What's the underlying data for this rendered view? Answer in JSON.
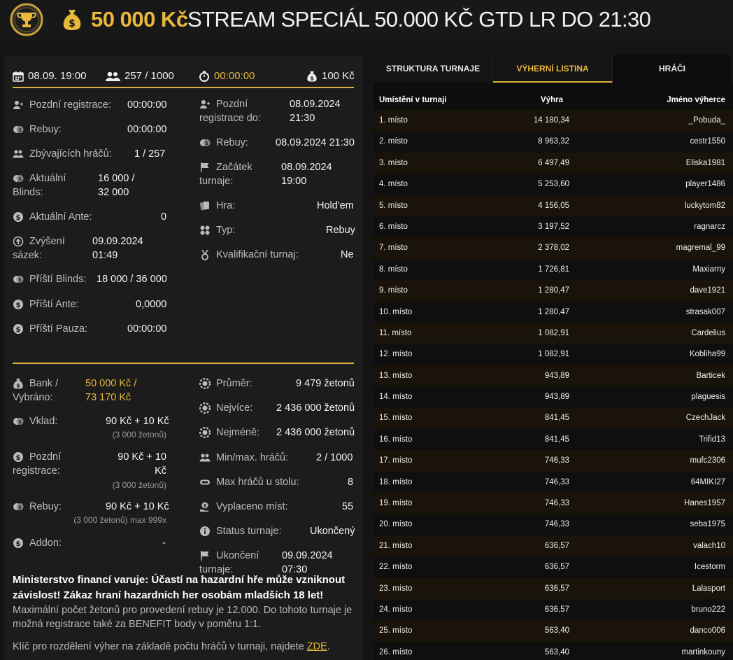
{
  "header": {
    "amount": "50 000 Kč",
    "title": "STREAM SPECIÁL 50.000 KČ GTD LR DO 21:30",
    "icons": [
      "trophy-icon",
      "money-bag-icon"
    ],
    "accent_color": "#e8b83b"
  },
  "topbar": {
    "date": "08.09. 19:00",
    "players": "257 / 1000",
    "timer": "00:00:00",
    "buyin": "100 Kč"
  },
  "info_left": [
    {
      "label": "Pozdní registrace:",
      "value": "00:00:00"
    },
    {
      "label": "Rebuy:",
      "value": "00:00:00"
    },
    {
      "label": "Zbývajících hráčů:",
      "value": "1 / 257"
    },
    {
      "label": "Aktuální Blinds:",
      "value": "16 000 / 32 000"
    },
    {
      "label": "Aktuální Ante:",
      "value": "0"
    },
    {
      "label": "Zvýšení sázek:",
      "value": "09.09.2024 01:49"
    },
    {
      "label": "Příští Blinds:",
      "value": "18 000 / 36 000"
    },
    {
      "label": "Příští Ante:",
      "value": "0,0000"
    },
    {
      "label": "Příští Pauza:",
      "value": "00:00:00"
    }
  ],
  "info_right": [
    {
      "label": "Pozdní registrace do:",
      "value": "08.09.2024 21:30"
    },
    {
      "label": "Rebuy:",
      "value": "08.09.2024 21:30"
    },
    {
      "label": "Začátek turnaje:",
      "value": "08.09.2024 19:00"
    },
    {
      "label": "Hra:",
      "value": "Hold'em"
    },
    {
      "label": "Typ:",
      "value": "Rebuy"
    },
    {
      "label": "Kvalifikační turnaj:",
      "value": "Ne"
    }
  ],
  "money_left": [
    {
      "label": "Bank / Vybráno:",
      "value": "50 000 Kč / 73 170 Kč"
    },
    {
      "label": "Vklad:",
      "value": "90 Kč + 10 Kč",
      "sub": "(3 000 žetonů)"
    },
    {
      "label": "Pozdní registrace:",
      "value": "90 Kč + 10 Kč",
      "sub": "(3 000 žetonů)"
    },
    {
      "label": "Rebuy:",
      "value": "90 Kč + 10 Kč",
      "sub": "(3 000 žetonů) max 999x"
    },
    {
      "label": "Addon:",
      "value": "-"
    }
  ],
  "money_right": [
    {
      "label": "Průměr:",
      "value": "9 479 žetonů"
    },
    {
      "label": "Nejvíce:",
      "value": "2 436 000 žetonů"
    },
    {
      "label": "Nejméně:",
      "value": "2 436 000 žetonů"
    },
    {
      "label": "Min/max. hráčů:",
      "value": "2 / 1000"
    },
    {
      "label": "Max hráčů u stolu:",
      "value": "8"
    },
    {
      "label": "Vyplaceno míst:",
      "value": "55"
    },
    {
      "label": "Status turnaje:",
      "value": "Ukončený"
    },
    {
      "label": "Ukončení turnaje:",
      "value": "09.09.2024 07:30"
    }
  ],
  "warning": "Ministerstvo financí varuje: Účastí na hazardní hře může vzniknout závislost! Zákaz hraní hazardních her osobám mladších 18 let!",
  "note": "Maximální počet žetonů pro provedení rebuy je 12.000. Do tohoto turnaje je možná registrace také za BENEFIT body v poměru 1:1.",
  "note2_text": "Klíč pro rozdělení výher na základě počtu hráčů v turnaji, najdete",
  "note2_link": "ZDE",
  "note2_end": ".",
  "tabs": [
    "STRUKTURA TURNAJE",
    "VÝHERNÍ LISTINA",
    "HRÁČI"
  ],
  "table": {
    "headers": [
      "Umístění v turnaji",
      "Výhra",
      "Jméno výherce"
    ],
    "rows": [
      [
        "1. místo",
        "14 180,34",
        "_Pobuda_"
      ],
      [
        "2. místo",
        "8 963,32",
        "cestr1550"
      ],
      [
        "3. místo",
        "6 497,49",
        "Eliska1981"
      ],
      [
        "4. místo",
        "5 253,60",
        "player1486"
      ],
      [
        "5. místo",
        "4 156,05",
        "luckytom82"
      ],
      [
        "6. místo",
        "3 197,52",
        "ragnarcz"
      ],
      [
        "7. místo",
        "2 378,02",
        "magremal_99"
      ],
      [
        "8. místo",
        "1 726,81",
        "Maxiarny"
      ],
      [
        "9. místo",
        "1 280,47",
        "dave1921"
      ],
      [
        "10. místo",
        "1 280,47",
        "strasak007"
      ],
      [
        "11. místo",
        "1 082,91",
        "Cardelius"
      ],
      [
        "12. místo",
        "1 082,91",
        "Kobliha99"
      ],
      [
        "13. místo",
        "943,89",
        "Barticek"
      ],
      [
        "14. místo",
        "943,89",
        "plaguesis"
      ],
      [
        "15. místo",
        "841,45",
        "CzechJack"
      ],
      [
        "16. místo",
        "841,45",
        "Trifid13"
      ],
      [
        "17. místo",
        "746,33",
        "mufc2306"
      ],
      [
        "18. místo",
        "746,33",
        "64MIKI27"
      ],
      [
        "19. místo",
        "746,33",
        "Hanes1957"
      ],
      [
        "20. místo",
        "746,33",
        "seba1975"
      ],
      [
        "21. místo",
        "636,57",
        "valach10"
      ],
      [
        "22. místo",
        "636,57",
        "Icestorm"
      ],
      [
        "23. místo",
        "636,57",
        "Lalasport"
      ],
      [
        "24. místo",
        "636,57",
        "bruno222"
      ],
      [
        "25. místo",
        "563,40",
        "danco006"
      ],
      [
        "26. místo",
        "563,40",
        "martinkouny"
      ]
    ]
  }
}
